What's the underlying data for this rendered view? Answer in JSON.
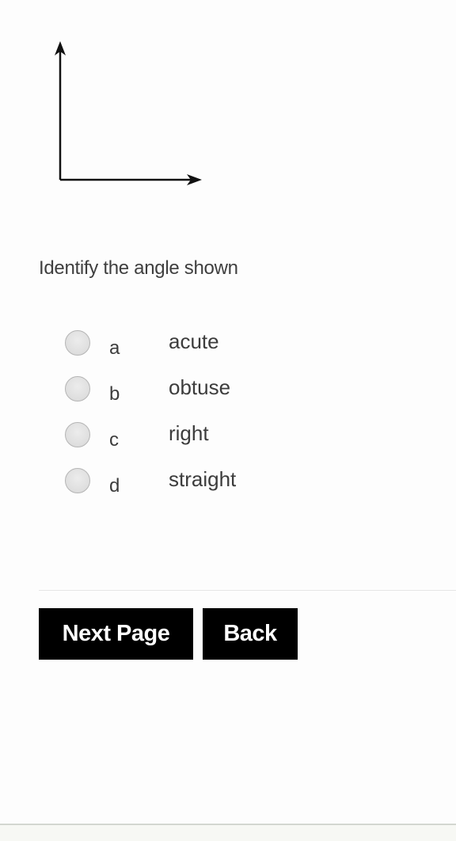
{
  "figure": {
    "description": "right angle formed by two rays with arrowheads (up and right)",
    "icon": "right-angle-diagram",
    "stroke_color": "#111111"
  },
  "question": {
    "text": "Identify the angle shown"
  },
  "options": [
    {
      "letter": "a",
      "label": "acute",
      "selected": false
    },
    {
      "letter": "b",
      "label": "obtuse",
      "selected": false
    },
    {
      "letter": "c",
      "label": "right",
      "selected": false
    },
    {
      "letter": "d",
      "label": "straight",
      "selected": false
    }
  ],
  "buttons": {
    "next_label": "Next Page",
    "back_label": "Back",
    "background": "#000000",
    "text_color": "#ffffff"
  }
}
